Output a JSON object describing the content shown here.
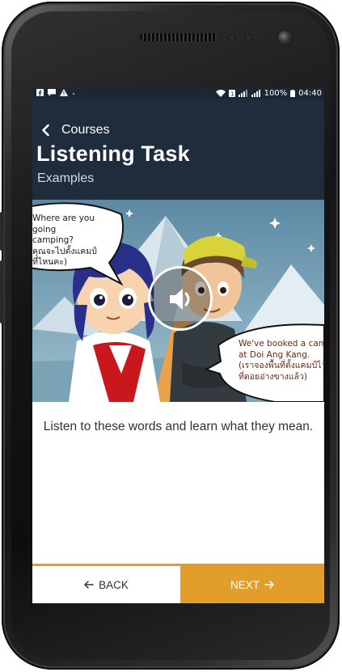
{
  "status_bar": {
    "left_icons": [
      "facebook-icon",
      "chat-icon",
      "warning-icon"
    ],
    "battery_text": "100%",
    "time": "04:40"
  },
  "header": {
    "back_label": "Courses",
    "title": "Listening Task",
    "subtitle": "Examples"
  },
  "media": {
    "speech_left_line1": "Where are you going",
    "speech_left_line2": "camping?",
    "speech_left_line3": "คุณจะไปตั้งแคมป์",
    "speech_left_line4": "ที่ไหนคะ)",
    "speech_right_line1": "We've booked a camps",
    "speech_right_line2": "at Doi Ang Kang.",
    "speech_right_line3": "(เราจองพื้นที่ตั้งแคมป์ไว้",
    "speech_right_line4": "ที่ดอยอ่างขางแล้ว)",
    "play_icon": "speaker-icon"
  },
  "content": {
    "instruction": "Listen to these words and learn what they mean."
  },
  "nav": {
    "back_label": "BACK",
    "next_label": "NEXT"
  },
  "colors": {
    "header_bg": "#1f2c3c",
    "accent": "#e29e2a",
    "text": "#333333"
  }
}
